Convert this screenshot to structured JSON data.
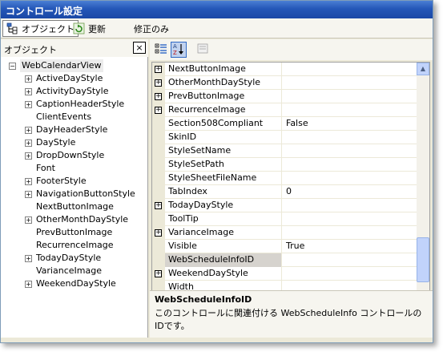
{
  "window": {
    "title": "コントロール設定"
  },
  "toolbar": {
    "object_label": "オブジェクト",
    "update_label": "更新",
    "modified_only_label": "修正のみ"
  },
  "left": {
    "header": "オブジェクト",
    "close": "×",
    "root": "WebCalendarView",
    "items": [
      {
        "label": "ActiveDayStyle",
        "expandable": true
      },
      {
        "label": "ActivityDayStyle",
        "expandable": true
      },
      {
        "label": "CaptionHeaderStyle",
        "expandable": true
      },
      {
        "label": "ClientEvents",
        "expandable": false
      },
      {
        "label": "DayHeaderStyle",
        "expandable": true
      },
      {
        "label": "DayStyle",
        "expandable": true
      },
      {
        "label": "DropDownStyle",
        "expandable": true
      },
      {
        "label": "Font",
        "expandable": false
      },
      {
        "label": "FooterStyle",
        "expandable": true
      },
      {
        "label": "NavigationButtonStyle",
        "expandable": true
      },
      {
        "label": "NextButtonImage",
        "expandable": false
      },
      {
        "label": "OtherMonthDayStyle",
        "expandable": true
      },
      {
        "label": "PrevButtonImage",
        "expandable": false
      },
      {
        "label": "RecurrenceImage",
        "expandable": false
      },
      {
        "label": "TodayDayStyle",
        "expandable": true
      },
      {
        "label": "VarianceImage",
        "expandable": false
      },
      {
        "label": "WeekendDayStyle",
        "expandable": true
      }
    ]
  },
  "grid": {
    "rows": [
      {
        "name": "NextButtonImage",
        "value": "",
        "expandable": true
      },
      {
        "name": "OtherMonthDayStyle",
        "value": "",
        "expandable": true
      },
      {
        "name": "PrevButtonImage",
        "value": "",
        "expandable": true
      },
      {
        "name": "RecurrenceImage",
        "value": "",
        "expandable": true
      },
      {
        "name": "Section508Compliant",
        "value": "False",
        "expandable": false
      },
      {
        "name": "SkinID",
        "value": "",
        "expandable": false
      },
      {
        "name": "StyleSetName",
        "value": "",
        "expandable": false
      },
      {
        "name": "StyleSetPath",
        "value": "",
        "expandable": false
      },
      {
        "name": "StyleSheetFileName",
        "value": "",
        "expandable": false
      },
      {
        "name": "TabIndex",
        "value": "0",
        "expandable": false
      },
      {
        "name": "TodayDayStyle",
        "value": "",
        "expandable": true
      },
      {
        "name": "ToolTip",
        "value": "",
        "expandable": false
      },
      {
        "name": "VarianceImage",
        "value": "",
        "expandable": true
      },
      {
        "name": "Visible",
        "value": "True",
        "expandable": false
      },
      {
        "name": "WebScheduleInfoID",
        "value": "",
        "expandable": false,
        "selected": true
      },
      {
        "name": "WeekendDayStyle",
        "value": "",
        "expandable": true
      },
      {
        "name": "Width",
        "value": "",
        "expandable": false
      }
    ]
  },
  "description": {
    "title": "WebScheduleInfoID",
    "text": "このコントロールに関連付ける WebScheduleInfo コントロールのIDです。"
  },
  "colors": {
    "titlebar": "#2457b8",
    "selection": "#d6d3ce",
    "sort_active": "#c1d2ee"
  }
}
